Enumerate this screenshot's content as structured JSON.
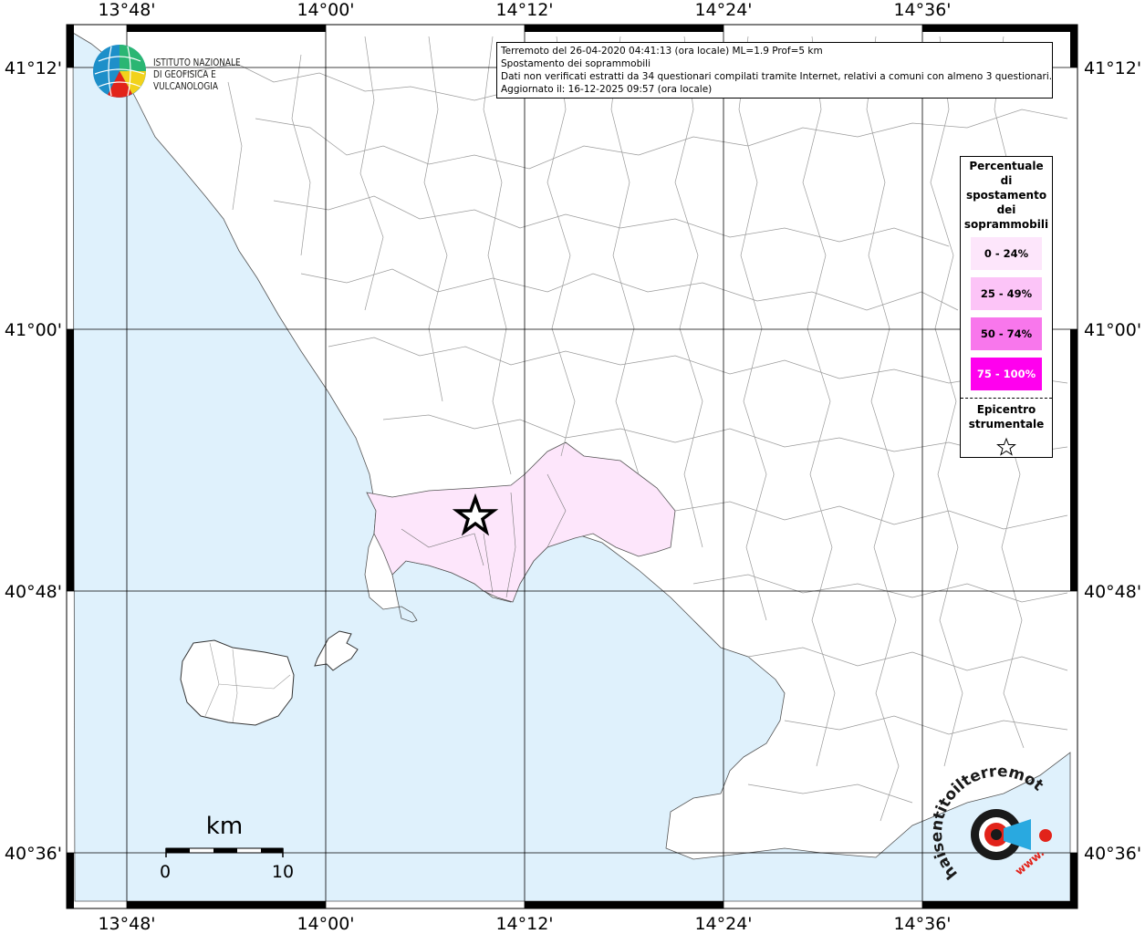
{
  "header": {
    "line1": "Terremoto del 26-04-2020 04:41:13 (ora locale) ML=1.9 Prof=5 km",
    "line2": "Spostamento dei soprammobili",
    "line3": "Dati non verificati estratti da 34 questionari compilati tramite Internet, relativi a comuni con almeno 3 questionari.",
    "line4": "Aggiornato il: 16-12-2025 09:57 (ora locale)"
  },
  "logo": {
    "line1": "ISTITUTO NAZIONALE",
    "line2": "DI GEOFISICA E VULCANOLOGIA"
  },
  "lon_labels": [
    "13°48'",
    "14°00'",
    "14°12'",
    "14°24'",
    "14°36'"
  ],
  "lat_labels": [
    "41°12'",
    "41°00'",
    "40°48'",
    "40°36'"
  ],
  "legend": {
    "title_lines": [
      "Percentuale",
      "di",
      "spostamento",
      "dei",
      "soprammobili"
    ],
    "items": [
      {
        "label": "0 - 24%",
        "color": "#fde6fb"
      },
      {
        "label": "25 - 49%",
        "color": "#fcc4f7"
      },
      {
        "label": "50 - 74%",
        "color": "#f877ec"
      },
      {
        "label": "75 - 100%",
        "color": "#ff00ee"
      }
    ],
    "epicenter_lines": [
      "Epicentro",
      "strumentale"
    ],
    "epicenter_symbol": "star-icon"
  },
  "scale_bar": {
    "unit": "km",
    "start": "0",
    "end": "10"
  },
  "watermark": {
    "text": "haisentitoilterremoto.it",
    "prefix": "www."
  },
  "colors": {
    "sea": "#dff1fc",
    "land": "#ffffff",
    "affected": "#fde6fb",
    "grid": "#000000"
  }
}
